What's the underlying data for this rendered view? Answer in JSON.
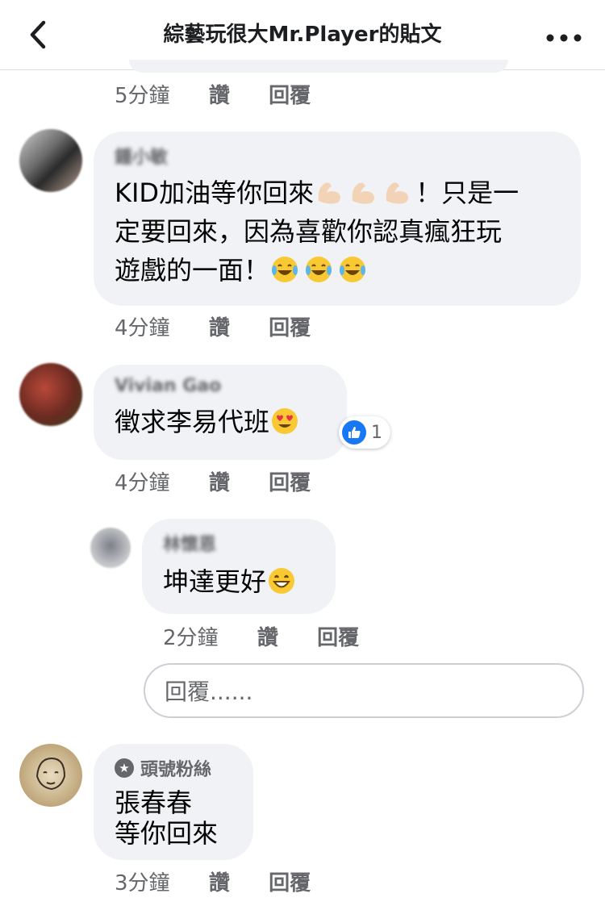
{
  "header": {
    "title": "綜藝玩很大Mr.Player的貼文",
    "back_icon": "chevron-left-icon",
    "more_icon": "more-horizontal-icon"
  },
  "top_meta": {
    "time": "5分鐘",
    "like": "讚",
    "reply": "回覆"
  },
  "comments": [
    {
      "name": "鍾小敏",
      "text_line1": "KID加油等你回來",
      "text_line1_end": "！只是一",
      "text_line2": "定要回來，因為喜歡你認真瘋狂玩",
      "text_line3": "遊戲的一面！",
      "emojis": [
        "flexed-biceps",
        "flexed-biceps",
        "flexed-biceps",
        "tears-of-joy",
        "tears-of-joy",
        "tears-of-joy"
      ],
      "time": "4分鐘",
      "like": "讚",
      "reply": "回覆"
    },
    {
      "name": "Vivian Gao",
      "text": "徵求李易代班",
      "emoji": "heart-eyes",
      "reaction_count": "1",
      "time": "4分鐘",
      "like": "讚",
      "reply": "回覆"
    },
    {
      "name": "林懷恩",
      "text": "坤達更好",
      "emoji": "grinning",
      "time": "2分鐘",
      "like": "讚",
      "reply": "回覆"
    },
    {
      "badge": "頭號粉絲",
      "text_line1": "張春春",
      "text_line2": "等你回來",
      "time": "3分鐘",
      "like": "讚",
      "reply": "回覆"
    }
  ],
  "reply_input": {
    "placeholder": "回覆......"
  },
  "colors": {
    "bubble": "#f0f2f5",
    "like_blue": "#1877f2",
    "meta_gray": "#65676b"
  }
}
